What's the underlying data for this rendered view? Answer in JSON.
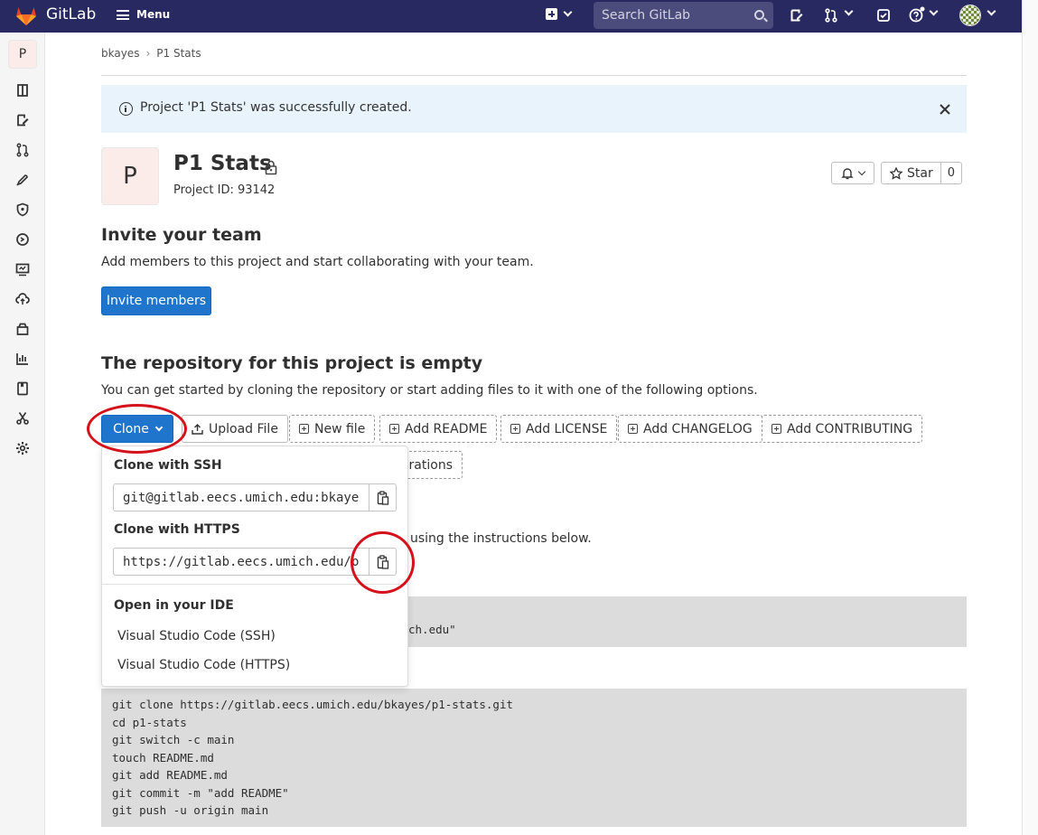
{
  "topbar": {
    "brand": "GitLab",
    "menu_label": "Menu",
    "search_placeholder": "Search GitLab",
    "icons": [
      "plus-icon",
      "search-icon",
      "issues-icon",
      "merge-request-icon",
      "todo-icon",
      "help-icon",
      "avatar"
    ]
  },
  "sidebar": {
    "project_letter": "P",
    "items": [
      "project-icon",
      "issues-icon",
      "merge-requests-icon",
      "deployments-icon",
      "security-icon",
      "ci-cd-icon",
      "monitor-icon",
      "infrastructure-icon",
      "packages-icon",
      "analytics-icon",
      "wiki-icon",
      "snippets-icon",
      "settings-icon"
    ]
  },
  "breadcrumb": {
    "items": [
      "bkayes",
      "P1 Stats"
    ],
    "separator": "›"
  },
  "alert": {
    "text": "Project 'P1 Stats' was successfully created."
  },
  "project": {
    "letter": "P",
    "name": "P1 Stats",
    "id_text": "Project ID: 93142",
    "star_label": "Star",
    "star_count": "0"
  },
  "invite": {
    "heading": "Invite your team",
    "description": "Add members to this project and start collaborating with your team.",
    "button": "Invite members"
  },
  "empty_repo": {
    "heading": "The repository for this project is empty",
    "description": "You can get started by cloning the repository or start adding files to it with one of the following options.",
    "buttons": {
      "clone": "Clone",
      "upload": "Upload File",
      "new_file": "New file",
      "readme": "Add README",
      "license": "Add LICENSE",
      "changelog": "Add CHANGELOG",
      "contributing": "Add CONTRIBUTING",
      "integrations_partial": "grations"
    },
    "instructions_partial": "using the instructions below.",
    "git_global_partial": "ch.edu\""
  },
  "clone_dropdown": {
    "ssh_heading": "Clone with SSH",
    "ssh_url": "git@gitlab.eecs.umich.edu:bkaye",
    "https_heading": "Clone with HTTPS",
    "https_url": "https://gitlab.eecs.umich.edu/b",
    "ide_heading": "Open in your IDE",
    "ide_items": [
      "Visual Studio Code (SSH)",
      "Visual Studio Code (HTTPS)"
    ]
  },
  "code_block": {
    "lines": [
      "git clone https://gitlab.eecs.umich.edu/bkayes/p1-stats.git",
      "cd p1-stats",
      "git switch -c main",
      "touch README.md",
      "git add README.md",
      "git commit -m \"add README\"",
      "git push -u origin main"
    ]
  },
  "colors": {
    "topbar": "#292961",
    "primary": "#1f75cb",
    "annotation": "#d4121b",
    "alert_bg": "#e9f3fc"
  }
}
